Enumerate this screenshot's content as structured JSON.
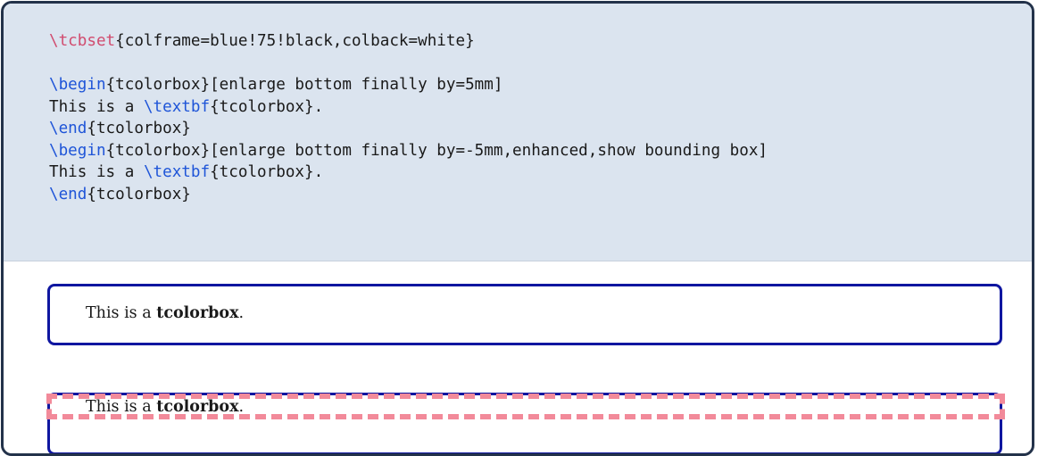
{
  "code_lines": [
    [
      {
        "t": "\\tcbset",
        "c": "kw-red"
      },
      {
        "t": "{colframe=blue!75!black,colback=white}"
      }
    ],
    [],
    [
      {
        "t": "\\begin",
        "c": "kw-blue"
      },
      {
        "t": "{tcolorbox}[enlarge bottom finally by=5mm]"
      }
    ],
    [
      {
        "t": "This is a "
      },
      {
        "t": "\\textbf",
        "c": "kw-blue"
      },
      {
        "t": "{tcolorbox}."
      }
    ],
    [
      {
        "t": "\\end",
        "c": "kw-blue"
      },
      {
        "t": "{tcolorbox}"
      }
    ],
    [
      {
        "t": "\\begin",
        "c": "kw-blue"
      },
      {
        "t": "{tcolorbox}[enlarge bottom finally by=-5mm,enhanced,show bounding box]"
      }
    ],
    [
      {
        "t": "This is a "
      },
      {
        "t": "\\textbf",
        "c": "kw-blue"
      },
      {
        "t": "{tcolorbox}."
      }
    ],
    [
      {
        "t": "\\end",
        "c": "kw-blue"
      },
      {
        "t": "{tcolorbox}"
      }
    ]
  ],
  "output": {
    "box1": {
      "prefix": "This is a ",
      "bold": "tcolorbox",
      "suffix": "."
    },
    "box2": {
      "prefix": "This is a ",
      "bold": "tcolorbox",
      "suffix": "."
    }
  },
  "colors": {
    "frame_outer": "#23324a",
    "code_background": "#dbe4ef",
    "box_frame": "#0f16a0",
    "keyword_red": "#d14c6f",
    "keyword_blue": "#1f55d8",
    "bounding_box": "#f28a9a"
  }
}
